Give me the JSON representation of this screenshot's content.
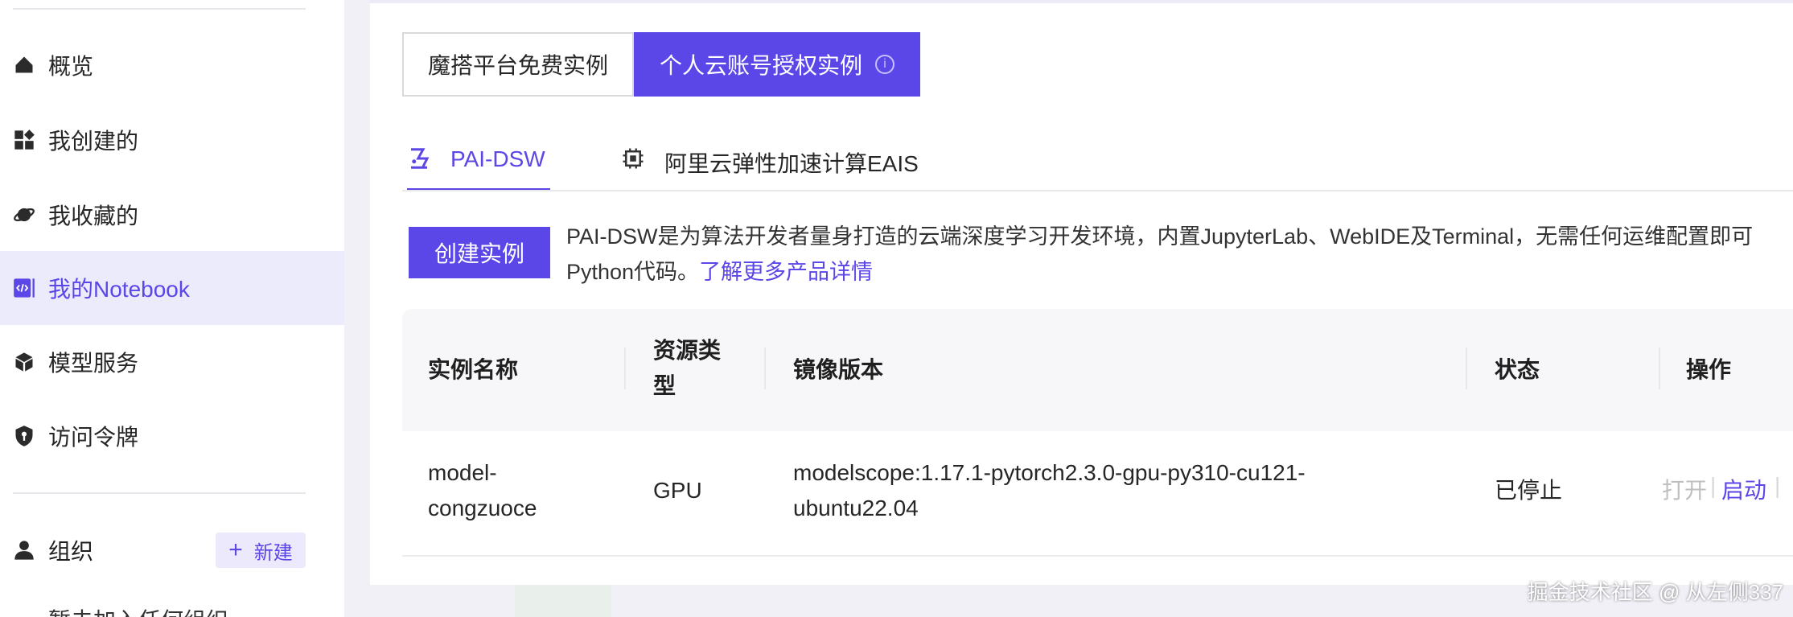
{
  "sidebar": {
    "items": [
      {
        "label": "概览",
        "icon": "home-icon"
      },
      {
        "label": "我创建的",
        "icon": "dashboard-icon"
      },
      {
        "label": "我收藏的",
        "icon": "planet-icon"
      },
      {
        "label": "我的Notebook",
        "icon": "code-icon"
      },
      {
        "label": "模型服务",
        "icon": "cube-icon"
      },
      {
        "label": "访问令牌",
        "icon": "shield-icon"
      }
    ],
    "org_label": "组织",
    "new_label": "新建",
    "cutoff_text": "暂未加入任何组织"
  },
  "segments": {
    "free": "魔搭平台免费实例",
    "personal": "个人云账号授权实例"
  },
  "tabs": {
    "dsw": "PAI-DSW",
    "eais": "阿里云弹性加速计算EAIS"
  },
  "create_button": "创建实例",
  "description": {
    "line1": "PAI-DSW是为算法开发者量身打造的云端深度学习开发环境，内置JupyterLab、WebIDE及Terminal，无需任何运维配置即可",
    "line2": "Python代码。",
    "link": "了解更多产品详情"
  },
  "table": {
    "headers": {
      "name": "实例名称",
      "resource_1": "资源类",
      "resource_2": "型",
      "image": "镜像版本",
      "status": "状态",
      "ops": "操作"
    },
    "rows": [
      {
        "name_1": "model-",
        "name_2": "congzuoce",
        "resource": "GPU",
        "image_1": "modelscope:1.17.1-pytorch2.3.0-gpu-py310-cu121-",
        "image_2": "ubuntu22.04",
        "status": "已停止",
        "op_open": "打开",
        "op_start": "启动"
      }
    ]
  },
  "watermark": "掘金技术社区 @ 从左侧337",
  "colors": {
    "accent": "#5b46e8",
    "active_bg": "#ecebfb"
  }
}
